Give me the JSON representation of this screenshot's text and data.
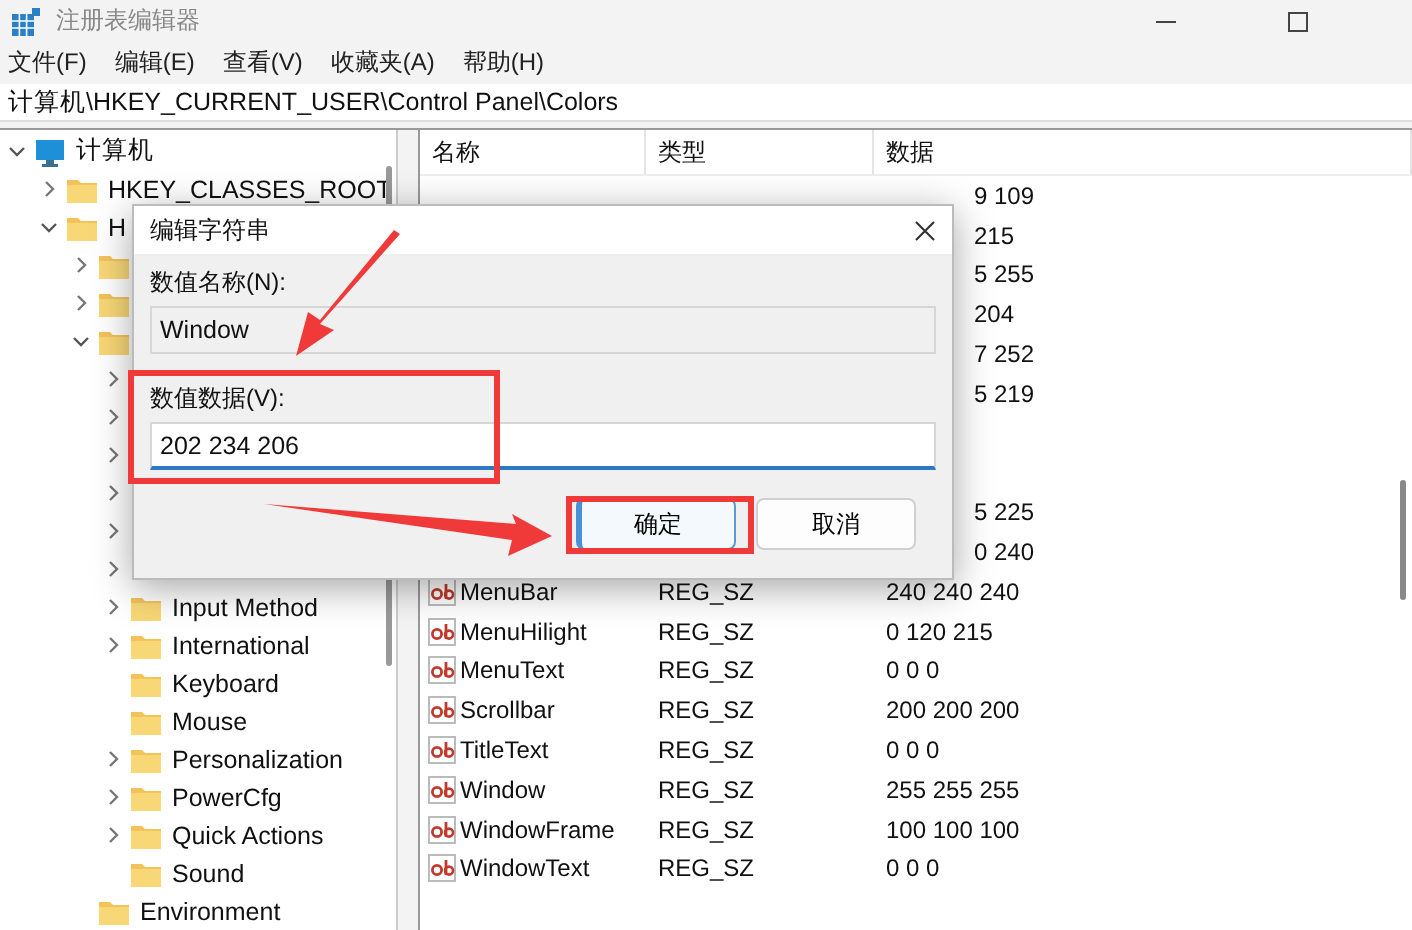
{
  "window": {
    "title": "注册表编辑器"
  },
  "menu": [
    "文件(F)",
    "编辑(E)",
    "查看(V)",
    "收藏夹(A)",
    "帮助(H)"
  ],
  "address": "计算机\\HKEY_CURRENT_USER\\Control Panel\\Colors",
  "tree": [
    {
      "kind": "computer",
      "label": "计算机",
      "expanded": true,
      "children": [
        {
          "kind": "folder",
          "label": "HKEY_CLASSES_ROOT",
          "expanded": false
        },
        {
          "kind": "folder",
          "label": "H",
          "expanded": true,
          "children": [
            {
              "kind": "folder",
              "expanded": false
            },
            {
              "kind": "folder",
              "expanded": false
            },
            {
              "kind": "folder",
              "expanded": true,
              "children": [
                {
                  "kind": "folder",
                  "expanded": false
                },
                {
                  "kind": "folder",
                  "expanded": false
                },
                {
                  "kind": "folder",
                  "expanded": false
                },
                {
                  "kind": "folder",
                  "expanded": false
                },
                {
                  "kind": "folder",
                  "expanded": false
                },
                {
                  "kind": "folder",
                  "expanded": false
                },
                {
                  "kind": "folder",
                  "label": "Input Method",
                  "expanded": false
                },
                {
                  "kind": "folder",
                  "label": "International",
                  "expanded": false
                },
                {
                  "kind": "folder",
                  "label": "Keyboard"
                },
                {
                  "kind": "folder",
                  "label": "Mouse"
                },
                {
                  "kind": "folder",
                  "label": "Personalization",
                  "expanded": false
                },
                {
                  "kind": "folder",
                  "label": "PowerCfg",
                  "expanded": false
                },
                {
                  "kind": "folder",
                  "label": "Quick Actions",
                  "expanded": false
                },
                {
                  "kind": "folder",
                  "label": "Sound"
                }
              ]
            },
            {
              "kind": "folder",
              "label": "Environment"
            }
          ]
        }
      ]
    }
  ],
  "list": {
    "columns": [
      "名称",
      "类型",
      "数据"
    ],
    "rows": [
      {
        "kind": "partial",
        "data": "9 109"
      },
      {
        "kind": "partial",
        "data": "215"
      },
      {
        "kind": "partial",
        "data": "5 255"
      },
      {
        "kind": "partial",
        "data": "204"
      },
      {
        "kind": "partial",
        "data": "7 252"
      },
      {
        "kind": "partial",
        "data": "5 219"
      },
      {
        "kind": "covered"
      },
      {
        "kind": "covered"
      },
      {
        "kind": "partial",
        "data": "5 225"
      },
      {
        "kind": "partial",
        "data": "0 240"
      },
      {
        "kind": "value",
        "name": "MenuBar",
        "type": "REG_SZ",
        "data": "240 240 240"
      },
      {
        "kind": "value",
        "name": "MenuHilight",
        "type": "REG_SZ",
        "data": "0 120 215"
      },
      {
        "kind": "value",
        "name": "MenuText",
        "type": "REG_SZ",
        "data": "0 0 0"
      },
      {
        "kind": "value",
        "name": "Scrollbar",
        "type": "REG_SZ",
        "data": "200 200 200"
      },
      {
        "kind": "value",
        "name": "TitleText",
        "type": "REG_SZ",
        "data": "0 0 0"
      },
      {
        "kind": "value",
        "name": "Window",
        "type": "REG_SZ",
        "data": "255 255 255"
      },
      {
        "kind": "value",
        "name": "WindowFrame",
        "type": "REG_SZ",
        "data": "100 100 100"
      },
      {
        "kind": "value",
        "name": "WindowText",
        "type": "REG_SZ",
        "data": "0 0 0"
      }
    ]
  },
  "dialog": {
    "title": "编辑字符串",
    "name_label": "数值名称(N):",
    "name_value": "Window",
    "data_label": "数值数据(V):",
    "data_value": "202 234 206",
    "buttons": [
      {
        "label": "确定",
        "focused": true
      },
      {
        "label": "取消",
        "focused": false
      }
    ]
  }
}
